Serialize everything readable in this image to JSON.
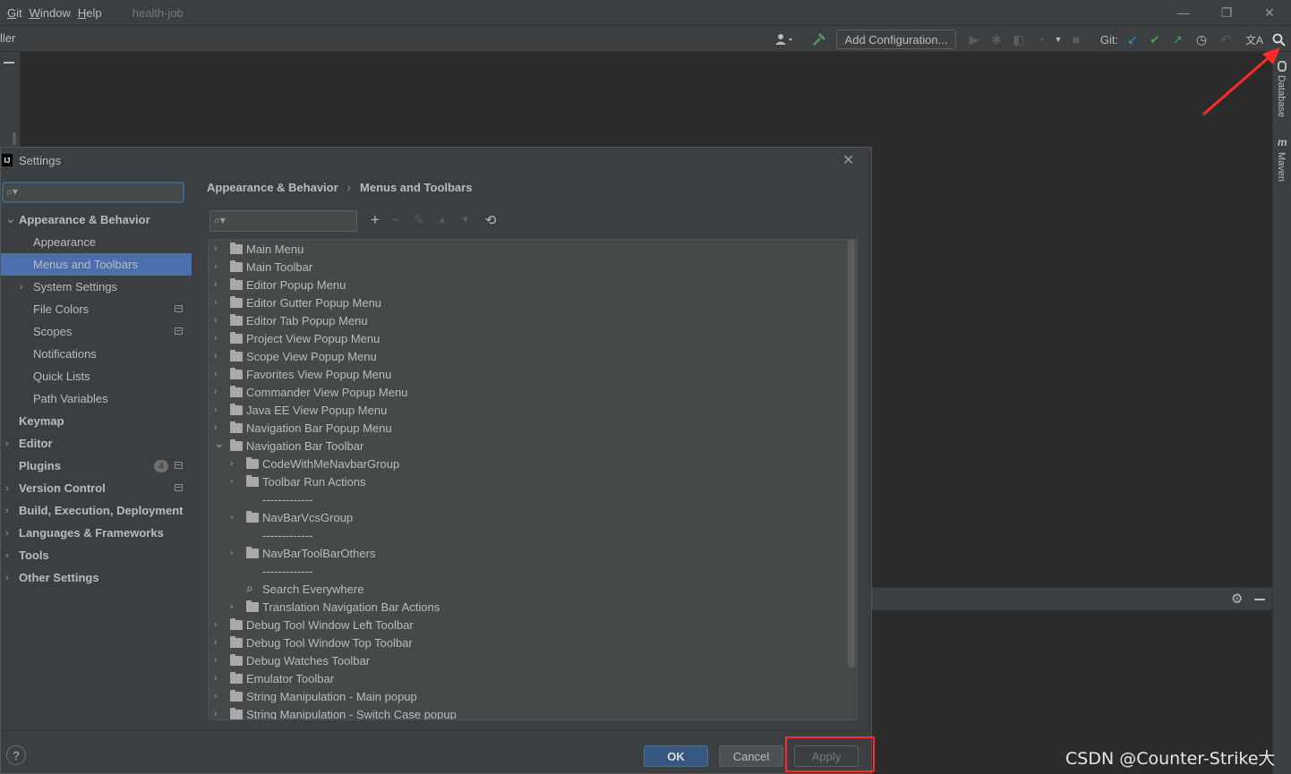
{
  "menubar": {
    "items": [
      "Git",
      "Window",
      "Help"
    ],
    "project": "health-job"
  },
  "toolbar": {
    "crumb": "ller",
    "add_configuration": "Add Configuration...",
    "git_label": "Git:"
  },
  "right_strip": {
    "database": "Database",
    "maven": "Maven",
    "maven_glyph": "m"
  },
  "dialog": {
    "title": "Settings",
    "logo_text": "IJ",
    "breadcrumb": {
      "parent": "Appearance & Behavior",
      "separator": "›",
      "current": "Menus and Toolbars"
    },
    "nav": [
      {
        "label": "Appearance & Behavior",
        "level": 0,
        "expanded": true,
        "bold": true
      },
      {
        "label": "Appearance",
        "level": 1
      },
      {
        "label": "Menus and Toolbars",
        "level": 1,
        "selected": true
      },
      {
        "label": "System Settings",
        "level": 1,
        "collapsed": true
      },
      {
        "label": "File Colors",
        "level": 1,
        "project_icon": true
      },
      {
        "label": "Scopes",
        "level": 1,
        "project_icon": true
      },
      {
        "label": "Notifications",
        "level": 1
      },
      {
        "label": "Quick Lists",
        "level": 1
      },
      {
        "label": "Path Variables",
        "level": 1
      },
      {
        "label": "Keymap",
        "level": 0,
        "bold": true
      },
      {
        "label": "Editor",
        "level": 0,
        "collapsed": true,
        "bold": true
      },
      {
        "label": "Plugins",
        "level": 0,
        "bold": true,
        "badge": "4",
        "project_icon": true
      },
      {
        "label": "Version Control",
        "level": 0,
        "collapsed": true,
        "bold": true,
        "project_icon": true
      },
      {
        "label": "Build, Execution, Deployment",
        "level": 0,
        "collapsed": true,
        "bold": true
      },
      {
        "label": "Languages & Frameworks",
        "level": 0,
        "collapsed": true,
        "bold": true
      },
      {
        "label": "Tools",
        "level": 0,
        "collapsed": true,
        "bold": true
      },
      {
        "label": "Other Settings",
        "level": 0,
        "collapsed": true,
        "bold": true
      }
    ],
    "tree": [
      {
        "label": "Main Menu",
        "level": 0,
        "kind": "folder",
        "state": "collapsed"
      },
      {
        "label": "Main Toolbar",
        "level": 0,
        "kind": "folder",
        "state": "collapsed"
      },
      {
        "label": "Editor Popup Menu",
        "level": 0,
        "kind": "folder",
        "state": "collapsed"
      },
      {
        "label": "Editor Gutter Popup Menu",
        "level": 0,
        "kind": "folder",
        "state": "collapsed"
      },
      {
        "label": "Editor Tab Popup Menu",
        "level": 0,
        "kind": "folder",
        "state": "collapsed"
      },
      {
        "label": "Project View Popup Menu",
        "level": 0,
        "kind": "folder",
        "state": "collapsed"
      },
      {
        "label": "Scope View Popup Menu",
        "level": 0,
        "kind": "folder",
        "state": "collapsed"
      },
      {
        "label": "Favorites View Popup Menu",
        "level": 0,
        "kind": "folder",
        "state": "collapsed"
      },
      {
        "label": "Commander View Popup Menu",
        "level": 0,
        "kind": "folder",
        "state": "collapsed"
      },
      {
        "label": "Java EE View Popup Menu",
        "level": 0,
        "kind": "folder",
        "state": "collapsed"
      },
      {
        "label": "Navigation Bar Popup Menu",
        "level": 0,
        "kind": "folder",
        "state": "collapsed"
      },
      {
        "label": "Navigation Bar Toolbar",
        "level": 0,
        "kind": "folder",
        "state": "expanded"
      },
      {
        "label": "CodeWithMeNavbarGroup",
        "level": 1,
        "kind": "folder",
        "state": "collapsed"
      },
      {
        "label": "Toolbar Run Actions",
        "level": 1,
        "kind": "folder",
        "state": "collapsed"
      },
      {
        "label": "-------------",
        "level": 1,
        "kind": "separator"
      },
      {
        "label": "NavBarVcsGroup",
        "level": 1,
        "kind": "folder",
        "state": "collapsed"
      },
      {
        "label": "-------------",
        "level": 1,
        "kind": "separator"
      },
      {
        "label": "NavBarToolBarOthers",
        "level": 1,
        "kind": "folder",
        "state": "collapsed"
      },
      {
        "label": "-------------",
        "level": 1,
        "kind": "separator"
      },
      {
        "label": "Search Everywhere",
        "level": 1,
        "kind": "action"
      },
      {
        "label": "Translation Navigation Bar Actions",
        "level": 1,
        "kind": "folder",
        "state": "collapsed"
      },
      {
        "label": "Debug Tool Window Left Toolbar",
        "level": 0,
        "kind": "folder",
        "state": "collapsed"
      },
      {
        "label": "Debug Tool Window Top Toolbar",
        "level": 0,
        "kind": "folder",
        "state": "collapsed"
      },
      {
        "label": "Debug Watches Toolbar",
        "level": 0,
        "kind": "folder",
        "state": "collapsed"
      },
      {
        "label": "Emulator Toolbar",
        "level": 0,
        "kind": "folder",
        "state": "collapsed"
      },
      {
        "label": "String Manipulation - Main popup",
        "level": 0,
        "kind": "folder",
        "state": "collapsed"
      },
      {
        "label": "String Manipulation - Switch Case popup",
        "level": 0,
        "kind": "folder",
        "state": "collapsed"
      }
    ],
    "buttons": {
      "ok": "OK",
      "cancel": "Cancel",
      "apply": "Apply",
      "help": "?"
    }
  },
  "watermark": "CSDN @Counter-Strike大牛",
  "colors": {
    "accent_selection": "#4b6eaf",
    "annotation_red": "#ff2a2a",
    "git_update_blue": "#3592c4",
    "git_commit_green": "#499c54",
    "build_green": "#499c54"
  }
}
